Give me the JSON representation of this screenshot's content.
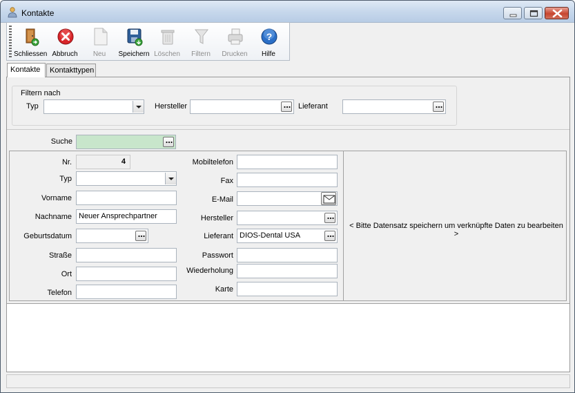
{
  "window": {
    "title": "Kontakte"
  },
  "toolbar": {
    "buttons": [
      {
        "label": "Schliessen",
        "icon": "door-exit-icon",
        "enabled": true
      },
      {
        "label": "Abbruch",
        "icon": "cancel-icon",
        "enabled": true
      },
      {
        "label": "Neu",
        "icon": "new-document-icon",
        "enabled": false
      },
      {
        "label": "Speichern",
        "icon": "save-disk-icon",
        "enabled": true
      },
      {
        "label": "Löschen",
        "icon": "trash-icon",
        "enabled": false
      },
      {
        "label": "Filtern",
        "icon": "filter-icon",
        "enabled": false
      },
      {
        "label": "Drucken",
        "icon": "printer-icon",
        "enabled": false
      },
      {
        "label": "Hilfe",
        "icon": "help-icon",
        "enabled": true
      }
    ]
  },
  "tabs": [
    {
      "label": "Kontakte",
      "active": true
    },
    {
      "label": "Kontakttypen",
      "active": false
    }
  ],
  "filter": {
    "legend": "Filtern nach",
    "typ_label": "Typ",
    "typ_value": "",
    "hersteller_label": "Hersteller",
    "hersteller_value": "",
    "lieferant_label": "Lieferant",
    "lieferant_value": ""
  },
  "search": {
    "label": "Suche",
    "value": ""
  },
  "form": {
    "nr_label": "Nr.",
    "nr_value": "4",
    "typ_label": "Typ",
    "typ_value": "",
    "vorname_label": "Vorname",
    "vorname_value": "",
    "nachname_label": "Nachname",
    "nachname_value": "Neuer Ansprechpartner",
    "geburtsdatum_label": "Geburtsdatum",
    "geburtsdatum_value": "",
    "strasse_label": "Straße",
    "strasse_value": "",
    "ort_label": "Ort",
    "ort_value": "",
    "telefon_label": "Telefon",
    "telefon_value": "",
    "mobiltelefon_label": "Mobiltelefon",
    "mobiltelefon_value": "",
    "fax_label": "Fax",
    "fax_value": "",
    "email_label": "E-Mail",
    "email_value": "",
    "hersteller_label": "Hersteller",
    "hersteller_value": "",
    "lieferant_label": "Lieferant",
    "lieferant_value": "DIOS-Dental USA",
    "passwort_label": "Passwort",
    "passwort_value": "",
    "wiederholung_label": "Wiederholung",
    "wiederholung_value": "",
    "karte_label": "Karte",
    "karte_value": ""
  },
  "hint": "< Bitte Datensatz speichern um verknüpfte Daten zu bearbeiten >",
  "colors": {
    "search_bg": "#c8e6cb",
    "titlebar": "#c7d8ec",
    "close_button": "#c7452f"
  }
}
